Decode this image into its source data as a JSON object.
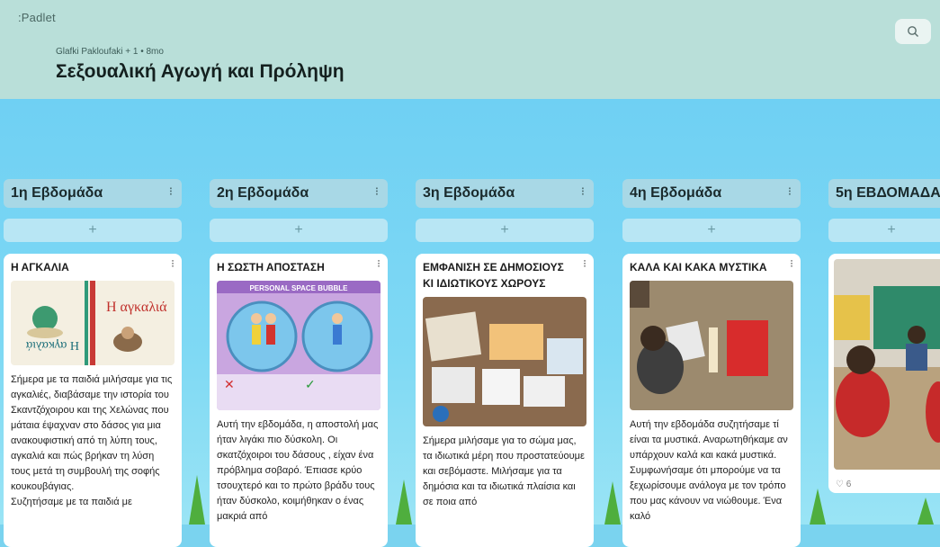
{
  "header": {
    "logo": ":Padlet",
    "author": "Glafki Pakloufaki + 1 • 8mo",
    "title": "Σεξουαλική Αγωγή και Πρόληψη",
    "search_icon": "search-icon"
  },
  "columns": [
    {
      "name": "1η Εβδομάδα",
      "add": "+",
      "card": {
        "title": "Η ΑΓΚΑΛΙΑ",
        "book_title": "Η αγκαλιά",
        "text": "Σήμερα με τα παιδιά μιλήσαμε για τις αγκαλιές, διαβάσαμε την ιστορία του Σκαντζόχοιρου και της Χελώνας που μάταια έψαχναν στο δάσος για μια ανακουφιστική από τη λύπη τους, αγκαλιά και πώς βρήκαν τη λύση τους μετά τη συμβουλή της σοφής κουκουβάγιας.\nΣυζητήσαμε με τα παιδιά με"
      }
    },
    {
      "name": "2η Εβδομάδα",
      "add": "+",
      "card": {
        "title": "Η ΣΩΣΤΗ ΑΠΟΣΤΑΣΗ",
        "poster_title": "PERSONAL SPACE BUBBLE",
        "text": "Αυτή την εβδομάδα, η αποστολή μας ήταν λιγάκι πιο δύσκολη. Οι σκατζόχοιροι του δάσους , είχαν ένα πρόβλημα σοβαρό. Έπιασε κρύο τσουχτερό και το πρώτο βράδυ τους ήταν δύσκολο, κοιμήθηκαν ο ένας μακριά από"
      }
    },
    {
      "name": "3η Εβδομάδα",
      "add": "+",
      "card": {
        "title": "ΕΜΦΑΝΙΣΗ ΣΕ ΔΗΜΟΣΙΟΥΣ ΚΙ ΙΔΙΩΤΙΚΟΥΣ ΧΩΡΟΥΣ",
        "text": "Σήμερα μιλήσαμε για το σώμα μας, τα ιδιωτικά μέρη που προστατεύουμε και σεβόμαστε. Μιλήσαμε για τα δημόσια και τα ιδιωτικά πλαίσια και σε ποια από"
      }
    },
    {
      "name": "4η Εβδομάδα",
      "add": "+",
      "card": {
        "title": "ΚΑΛΑ ΚΑΙ ΚΑΚΑ ΜΥΣΤΙΚΑ",
        "text": "Αυτή την εβδομάδα συζητήσαμε τί είναι τα μυστικά. Αναρωτηθήκαμε αν υπάρχουν καλά και κακά μυστικά. Συμφωνήσαμε ότι μπορούμε να τα ξεχωρίσουμε ανάλογα με τον τρόπο που μας κάνουν να νιώθουμε. Ένα καλό"
      }
    },
    {
      "name": "5η ΕΒΔΟΜΑΔΑ",
      "add": "+",
      "card": {
        "likes": "6"
      }
    }
  ],
  "colors": {
    "header_bg": "#b9dfd9",
    "sky": "#7ad3ef",
    "column_head": "#a8d8e6",
    "add_bar": "#b8e6f4"
  }
}
